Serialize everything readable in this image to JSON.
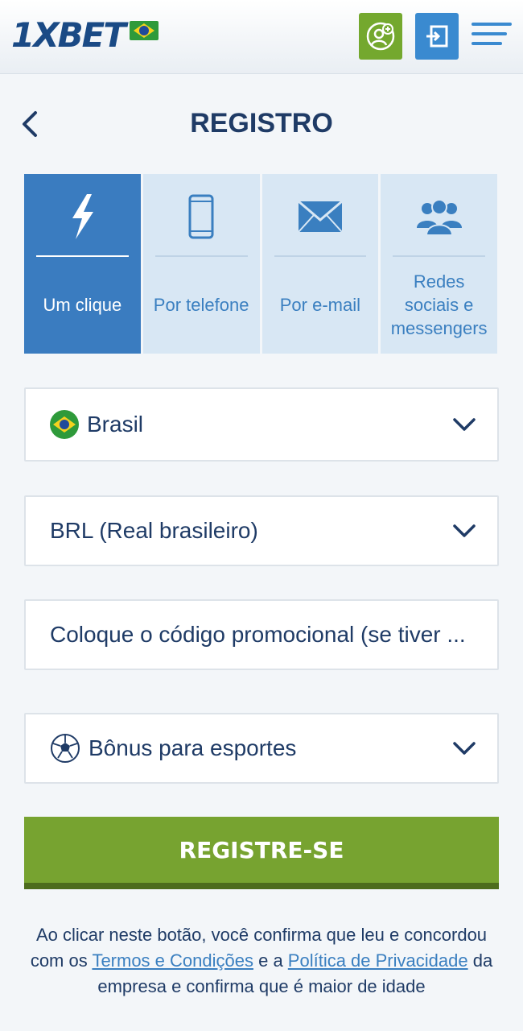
{
  "header": {
    "logo_text": "1XBET",
    "logo_flag_icon": "brazil-flag-icon",
    "user_button_icon": "add-user-icon",
    "login_button_icon": "login-icon",
    "menu_icon": "hamburger-menu-icon",
    "colors": {
      "user_button": "#74a82e",
      "login_button": "#3a8ad0"
    }
  },
  "page": {
    "title": "REGISTRO",
    "back_icon": "chevron-left-icon"
  },
  "tabs": [
    {
      "label": "Um clique",
      "icon": "lightning-icon",
      "active": true
    },
    {
      "label": "Por telefone",
      "icon": "phone-icon",
      "active": false
    },
    {
      "label": "Por e-mail",
      "icon": "envelope-icon",
      "active": false
    },
    {
      "label": "Redes sociais e messengers",
      "icon": "people-icon",
      "active": false
    }
  ],
  "form": {
    "country": "Brasil",
    "currency": "BRL (Real brasileiro)",
    "promo_placeholder": "Coloque o código promocional (se tiver ...",
    "bonus": "Bônus para esportes",
    "submit_label": "REGISTRE-SE"
  },
  "legal": {
    "text_before": "Ao clicar neste botão, você confirma que leu e concordou com os ",
    "terms_link": "Termos e Condições",
    "text_mid": " e a ",
    "privacy_link": "Política de Privacidade",
    "text_after": " da empresa e confirma que é maior de idade"
  },
  "colors": {
    "brand_blue": "#1a4a85",
    "active_tab": "#3a7cc0",
    "inactive_tab": "#d8e7f4",
    "register_green": "#77a330"
  }
}
